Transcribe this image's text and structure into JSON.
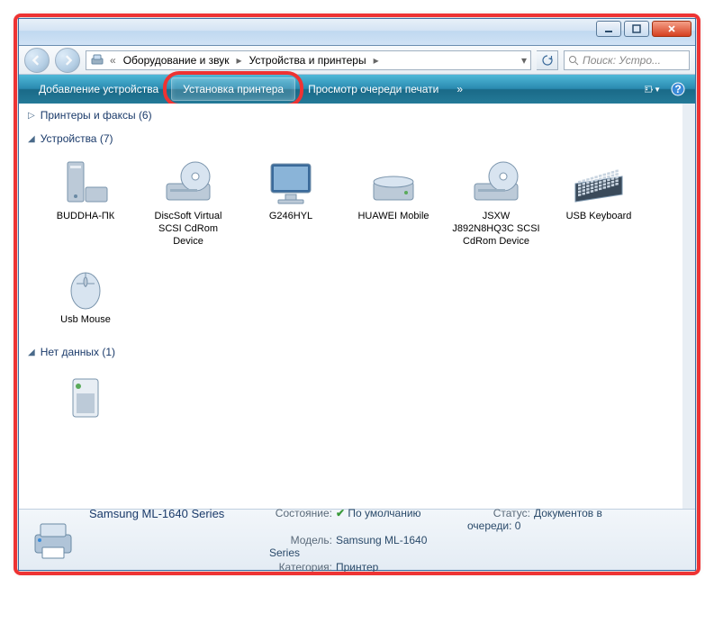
{
  "breadcrumbs": [
    "Оборудование и звук",
    "Устройства и принтеры"
  ],
  "search_placeholder": "Поиск: Устро...",
  "toolbar": {
    "add_device": "Добавление устройства",
    "install_printer": "Установка принтера",
    "view_queue": "Просмотр очереди печати"
  },
  "sections": {
    "printers": {
      "label": "Принтеры и факсы",
      "count": "(6)",
      "expanded": false
    },
    "devices": {
      "label": "Устройства",
      "count": "(7)",
      "expanded": true
    },
    "nodata": {
      "label": "Нет данных",
      "count": "(1)",
      "expanded": true
    }
  },
  "devices": [
    {
      "name": "BUDDHA-ПК",
      "icon": "pc"
    },
    {
      "name": "DiscSoft Virtual SCSI CdRom Device",
      "icon": "optical"
    },
    {
      "name": "G246HYL",
      "icon": "monitor"
    },
    {
      "name": "HUAWEI Mobile",
      "icon": "drive"
    },
    {
      "name": "JSXW J892N8HQ3C SCSI CdRom Device",
      "icon": "optical"
    },
    {
      "name": "USB Keyboard",
      "icon": "keyboard"
    },
    {
      "name": "Usb Mouse",
      "icon": "mouse"
    }
  ],
  "nodata_items": [
    {
      "name": "",
      "icon": "unknown"
    }
  ],
  "details": {
    "title": "Samsung ML-1640 Series",
    "state_k": "Состояние:",
    "state_v": "По умолчанию",
    "model_k": "Модель:",
    "model_v": "Samsung ML-1640 Series",
    "cat_k": "Категория:",
    "cat_v": "Принтер",
    "status_k": "Статус:",
    "status_v": "Документов в очереди: 0"
  }
}
